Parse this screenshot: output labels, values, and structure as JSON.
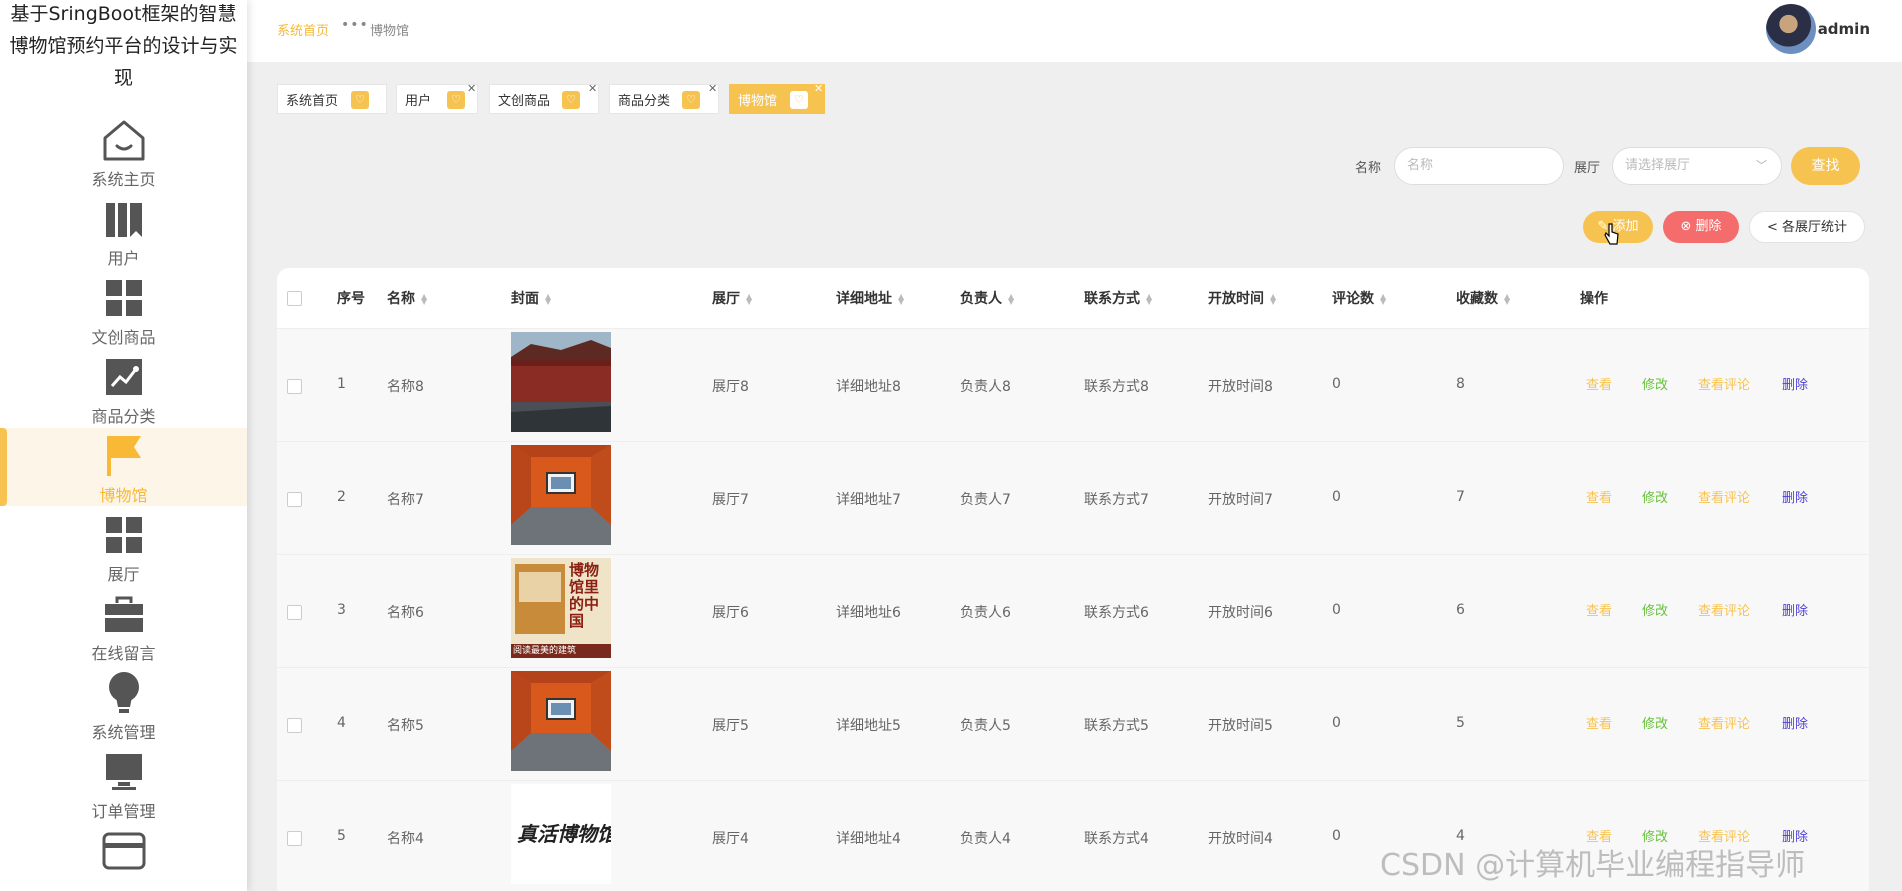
{
  "app": {
    "title": "基于SringBoot框架的智慧博物馆预约平台的设计与实现"
  },
  "sidebar": {
    "items": [
      {
        "label": "系统主页",
        "icon": "home-icon"
      },
      {
        "label": "用户",
        "icon": "books-icon"
      },
      {
        "label": "文创商品",
        "icon": "grid-icon"
      },
      {
        "label": "商品分类",
        "icon": "trend-chart-icon"
      },
      {
        "label": "博物馆",
        "icon": "flag-icon",
        "active": true
      },
      {
        "label": "展厅",
        "icon": "grid-icon"
      },
      {
        "label": "在线留言",
        "icon": "briefcase-icon"
      },
      {
        "label": "系统管理",
        "icon": "lightbulb-icon"
      },
      {
        "label": "订单管理",
        "icon": "monitor-icon"
      },
      {
        "label": "",
        "icon": "wallet-icon"
      }
    ]
  },
  "header": {
    "breadcrumb_home": "系统首页",
    "breadcrumb_sep": "•••",
    "breadcrumb_current": "博物馆",
    "username": "admin"
  },
  "tags": [
    {
      "label": "系统首页",
      "closable": false
    },
    {
      "label": "用户",
      "closable": true
    },
    {
      "label": "文创商品",
      "closable": true
    },
    {
      "label": "商品分类",
      "closable": true
    },
    {
      "label": "博物馆",
      "closable": true,
      "active": true
    }
  ],
  "search": {
    "name_label": "名称",
    "name_placeholder": "名称",
    "hall_label": "展厅",
    "hall_placeholder": "请选择展厅",
    "search_button": "查找"
  },
  "actions": {
    "add": "添加",
    "delete": "删除",
    "stats": "各展厅统计"
  },
  "table": {
    "columns": [
      "序号",
      "名称",
      "封面",
      "展厅",
      "详细地址",
      "负责人",
      "联系方式",
      "开放时间",
      "评论数",
      "收藏数",
      "操作"
    ],
    "row_actions": {
      "view": "查看",
      "edit": "修改",
      "view_comments": "查看评论",
      "delete": "删除"
    },
    "rows": [
      {
        "index": "1",
        "name": "名称8",
        "hall": "展厅8",
        "address": "详细地址8",
        "manager": "负责人8",
        "contact": "联系方式8",
        "open_time": "开放时间8",
        "comments": "0",
        "favorites": "8",
        "cover": "palace-wall-photo"
      },
      {
        "index": "2",
        "name": "名称7",
        "hall": "展厅7",
        "address": "详细地址7",
        "manager": "负责人7",
        "contact": "联系方式7",
        "open_time": "开放时间7",
        "comments": "0",
        "favorites": "7",
        "cover": "orange-gallery-photo"
      },
      {
        "index": "3",
        "name": "名称6",
        "hall": "展厅6",
        "address": "详细地址6",
        "manager": "负责人6",
        "contact": "联系方式6",
        "open_time": "开放时间6",
        "comments": "0",
        "favorites": "6",
        "cover": "book-cover-photo"
      },
      {
        "index": "4",
        "name": "名称5",
        "hall": "展厅5",
        "address": "详细地址5",
        "manager": "负责人5",
        "contact": "联系方式5",
        "open_time": "开放时间5",
        "comments": "0",
        "favorites": "5",
        "cover": "orange-gallery-photo"
      },
      {
        "index": "5",
        "name": "名称4",
        "hall": "展厅4",
        "address": "详细地址4",
        "manager": "负责人4",
        "contact": "联系方式4",
        "open_time": "开放时间4",
        "comments": "0",
        "favorites": "4",
        "cover": "calligraphy-photo"
      }
    ],
    "cover_text": {
      "book_title_1": "博物馆里的中国",
      "book_title_2": "阅读最美的建筑",
      "calligraphy": "真活博物馆"
    }
  },
  "watermark": "CSDN @计算机毕业编程指导师",
  "colors": {
    "accent": "#f7c350",
    "danger": "#f56c6c",
    "edit": "#67c23a",
    "delete_link": "#4d3fd6"
  }
}
